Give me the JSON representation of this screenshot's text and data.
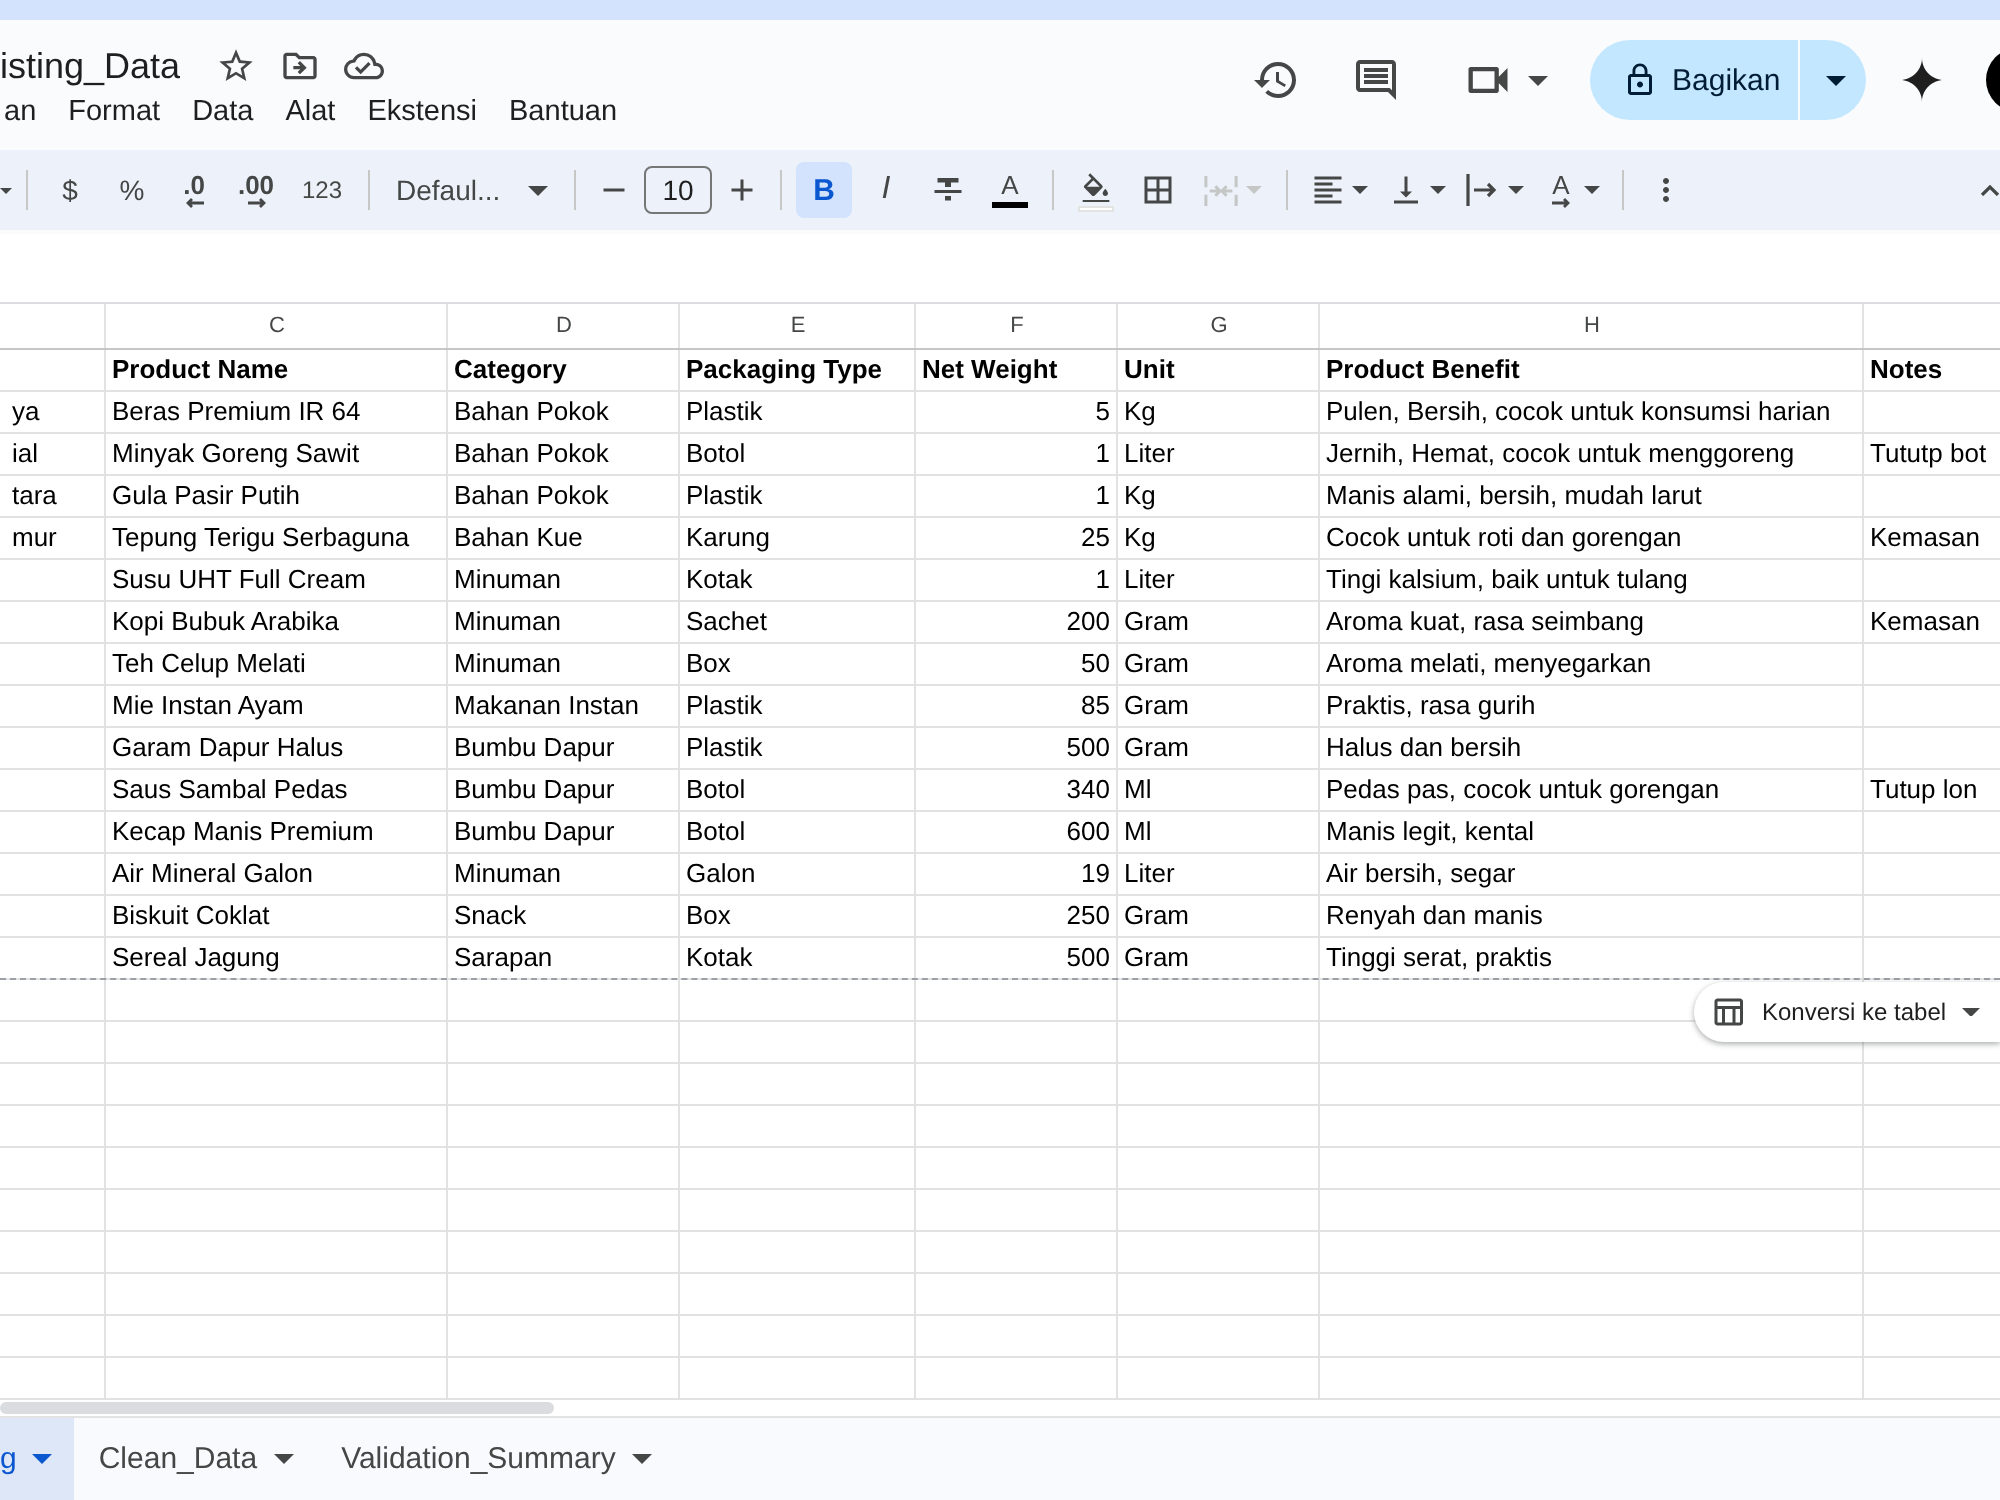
{
  "document": {
    "title": "isting_Data"
  },
  "menu": [
    "an",
    "Format",
    "Data",
    "Alat",
    "Ekstensi",
    "Bantuan"
  ],
  "share_button": {
    "label": "Bagikan"
  },
  "toolbar": {
    "currency": "$",
    "percent": "%",
    "decrease_decimal": ".0",
    "increase_decimal": ".00",
    "number_format": "123",
    "font": "Defaul...",
    "font_size": "10",
    "bold": {
      "label": "B",
      "on": true
    },
    "italic": {
      "label": "I",
      "on": false
    },
    "strikethrough": {
      "on": false
    },
    "text_color": "A",
    "merge_cells": {
      "disabled": true
    },
    "text_rotation": "A"
  },
  "sheet": {
    "column_letters": {
      "product_name": "C",
      "category": "D",
      "packaging_type": "E",
      "net_weight": "F",
      "unit": "G",
      "product_benefit": "H"
    },
    "header_row": {
      "product_name": "Product Name",
      "category": "Category",
      "packaging_type": "Packaging Type",
      "net_weight": "Net Weight",
      "unit": "Unit",
      "product_benefit": "Product Benefit",
      "notes": "Notes"
    },
    "rows": [
      {
        "column_1": "ya",
        "product_name": "Beras Premium IR 64",
        "category": "Bahan Pokok",
        "packaging_type": "Plastik",
        "net_weight": "5",
        "unit": "Kg",
        "product_benefit": "Pulen, Bersih, cocok untuk konsumsi harian"
      },
      {
        "column_1": "ial",
        "product_name": "Minyak Goreng Sawit",
        "category": "Bahan Pokok",
        "packaging_type": "Botol",
        "net_weight": "1",
        "unit": "Liter",
        "product_benefit": "Jernih, Hemat, cocok untuk menggoreng",
        "notes": "Tututp bot"
      },
      {
        "column_1": "tara",
        "product_name": "Gula Pasir Putih",
        "category": "Bahan Pokok",
        "packaging_type": "Plastik",
        "net_weight": "1",
        "unit": "Kg",
        "product_benefit": "Manis alami, bersih, mudah larut"
      },
      {
        "column_1": "mur",
        "product_name": "Tepung Terigu Serbaguna",
        "category": "Bahan Kue",
        "packaging_type": "Karung",
        "net_weight": "25",
        "unit": "Kg",
        "product_benefit": "Cocok untuk roti dan gorengan",
        "notes": "Kemasan"
      },
      {
        "product_name": "Susu UHT Full Cream",
        "category": "Minuman",
        "packaging_type": "Kotak",
        "net_weight": "1",
        "unit": "Liter",
        "product_benefit": "Tingi kalsium, baik untuk tulang"
      },
      {
        "product_name": "Kopi Bubuk Arabika",
        "category": "Minuman",
        "packaging_type": "Sachet",
        "net_weight": "200",
        "unit": "Gram",
        "product_benefit": "Aroma kuat, rasa seimbang",
        "notes": "Kemasan"
      },
      {
        "product_name": "Teh Celup Melati",
        "category": "Minuman",
        "packaging_type": "Box",
        "net_weight": "50",
        "unit": "Gram",
        "product_benefit": "Aroma melati, menyegarkan"
      },
      {
        "product_name": "Mie Instan Ayam",
        "category": "Makanan Instan",
        "packaging_type": "Plastik",
        "net_weight": "85",
        "unit": "Gram",
        "product_benefit": "Praktis, rasa gurih"
      },
      {
        "product_name": "Garam Dapur Halus",
        "category": "Bumbu Dapur",
        "packaging_type": "Plastik",
        "net_weight": "500",
        "unit": "Gram",
        "product_benefit": "Halus dan bersih"
      },
      {
        "product_name": "Saus Sambal Pedas",
        "category": "Bumbu Dapur",
        "packaging_type": "Botol",
        "net_weight": "340",
        "unit": "Ml",
        "product_benefit": "Pedas pas, cocok untuk gorengan",
        "notes": "Tutup lon"
      },
      {
        "product_name": "Kecap Manis Premium",
        "category": "Bumbu Dapur",
        "packaging_type": "Botol",
        "net_weight": "600",
        "unit": "Ml",
        "product_benefit": "Manis legit, kental"
      },
      {
        "product_name": "Air Mineral Galon",
        "category": "Minuman",
        "packaging_type": "Galon",
        "net_weight": "19",
        "unit": "Liter",
        "product_benefit": "Air bersih, segar"
      },
      {
        "product_name": "Biskuit Coklat",
        "category": "Snack",
        "packaging_type": "Box",
        "net_weight": "250",
        "unit": "Gram",
        "product_benefit": "Renyah dan manis"
      },
      {
        "product_name": "Sereal Jagung",
        "category": "Sarapan",
        "packaging_type": "Kotak",
        "net_weight": "500",
        "unit": "Gram",
        "product_benefit": "Tinggi serat, praktis"
      }
    ]
  },
  "table_chip": {
    "label": "Konversi ke tabel"
  },
  "sheet_tabs": [
    {
      "label": "g",
      "selected": true
    },
    {
      "label": "Clean_Data",
      "selected": false
    },
    {
      "label": "Validation_Summary",
      "selected": false
    }
  ]
}
